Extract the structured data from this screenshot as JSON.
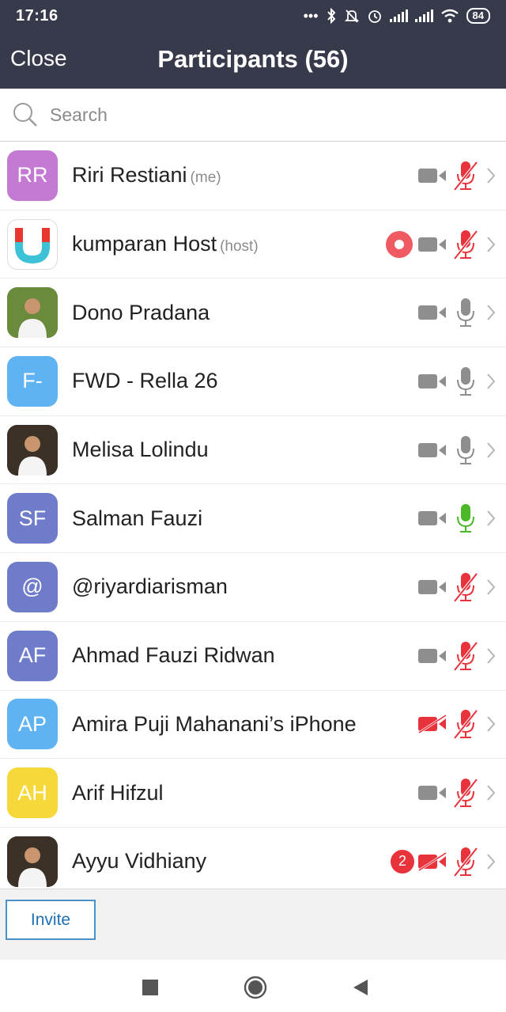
{
  "status_bar": {
    "time": "17:16",
    "battery": "84",
    "dots": "•••"
  },
  "header": {
    "close_label": "Close",
    "title": "Participants (56)"
  },
  "search": {
    "placeholder": "Search"
  },
  "participants": [
    {
      "initials": "RR",
      "avatar_color": "#c47ad2",
      "name": "Riri Restiani",
      "tag": "(me)",
      "video": "on",
      "audio": "muted"
    },
    {
      "initials": "",
      "avatar_type": "logo",
      "name": "kumparan Host",
      "tag": "(host)",
      "recording": true,
      "video": "on",
      "audio": "muted"
    },
    {
      "initials": "",
      "avatar_type": "photo",
      "name": "Dono Pradana",
      "tag": "",
      "video": "on",
      "audio": "unmuted"
    },
    {
      "initials": "F-",
      "avatar_color": "#5fb3f2",
      "name": "FWD - Rella 26",
      "tag": "",
      "video": "on",
      "audio": "unmuted"
    },
    {
      "initials": "",
      "avatar_type": "photo",
      "name": "Melisa Lolindu",
      "tag": "",
      "video": "on",
      "audio": "unmuted"
    },
    {
      "initials": "SF",
      "avatar_color": "#6f7cc9",
      "name": "Salman Fauzi",
      "tag": "",
      "video": "on",
      "audio": "speaking"
    },
    {
      "initials": "@",
      "avatar_color": "#6f7cc9",
      "name": "@riyardiarisman",
      "tag": "",
      "video": "on",
      "audio": "muted"
    },
    {
      "initials": "AF",
      "avatar_color": "#6f7cc9",
      "name": "Ahmad Fauzi Ridwan",
      "tag": "",
      "video": "on",
      "audio": "muted"
    },
    {
      "initials": "AP",
      "avatar_color": "#5fb3f2",
      "name": "Amira Puji Mahanani’s iPhone",
      "tag": "",
      "video": "off",
      "audio": "muted"
    },
    {
      "initials": "AH",
      "avatar_color": "#f7d83a",
      "name": "Arif Hifzul",
      "tag": "",
      "video": "on",
      "audio": "muted"
    },
    {
      "initials": "",
      "avatar_type": "photo",
      "name": "Ayyu Vidhiany",
      "tag": "",
      "badge": "2",
      "video": "off",
      "audio": "muted"
    }
  ],
  "footer": {
    "invite_label": "Invite"
  },
  "colors": {
    "header_bg": "#373a4b",
    "muted_red": "#e8323c",
    "speaking_green": "#4cb828",
    "icon_gray": "#8e8e8e",
    "invite_blue": "#1d6fb3"
  }
}
